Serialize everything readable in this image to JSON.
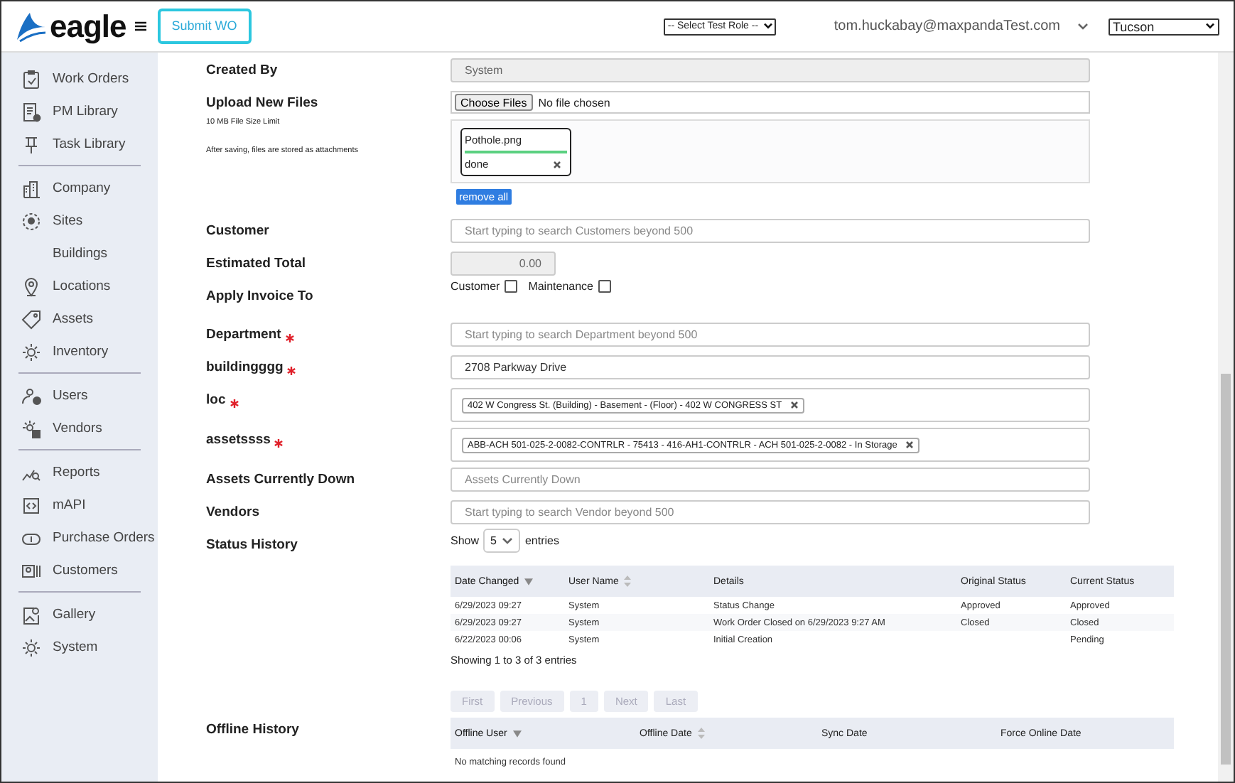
{
  "header": {
    "logo": "eagle",
    "submit_button": "Submit WO",
    "role_select": "-- Select Test Role --",
    "user": "tom.huckabay@maxpandaTest.com",
    "site_select": "Tucson"
  },
  "sidebar": {
    "groups": [
      [
        {
          "label": "Work Orders"
        },
        {
          "label": "PM Library"
        },
        {
          "label": "Task Library"
        }
      ],
      [
        {
          "label": "Company"
        },
        {
          "label": "Sites"
        },
        {
          "label": "Buildings"
        },
        {
          "label": "Locations"
        },
        {
          "label": "Assets"
        },
        {
          "label": "Inventory"
        }
      ],
      [
        {
          "label": "Users"
        },
        {
          "label": "Vendors"
        }
      ],
      [
        {
          "label": "Reports"
        },
        {
          "label": "mAPI"
        },
        {
          "label": "Purchase Orders"
        },
        {
          "label": "Customers"
        }
      ],
      [
        {
          "label": "Gallery"
        },
        {
          "label": "System"
        }
      ]
    ]
  },
  "form": {
    "fields": [
      {
        "kind": "readonly",
        "label": "Created By",
        "value": "System"
      },
      {
        "kind": "upload",
        "label": "Upload New Files",
        "notes": [
          "10 MB File Size Limit",
          "After saving, files are stored as attachments"
        ],
        "file_button": "Choose Files",
        "file_status": "No file chosen",
        "files": [
          {
            "name": "Pothole.png",
            "level": 1,
            "status": "done"
          }
        ],
        "remove_all": "remove all"
      },
      {
        "kind": "text",
        "label": "Customer",
        "placeholder": "Start typing to search Customers beyond 500"
      },
      {
        "kind": "short",
        "label": "Estimated Total",
        "value": "0.00"
      },
      {
        "kind": "checks",
        "label": "Apply Invoice To",
        "options": [
          {
            "label": "Customer",
            "checked": false
          },
          {
            "label": "Maintenance",
            "checked": false
          }
        ]
      },
      {
        "kind": "text",
        "label": "Department",
        "required": true,
        "placeholder": "Start typing to search Department beyond 500"
      },
      {
        "kind": "text",
        "label": "buildingggg",
        "required": true,
        "value": "2708 Parkway Drive"
      },
      {
        "kind": "tags",
        "label": "loc",
        "required": true,
        "tags": [
          "402 W Congress St. (Building) - Basement - (Floor) - 402 W CONGRESS ST"
        ]
      },
      {
        "kind": "tags",
        "label": "assetssss",
        "required": true,
        "tags": [
          "ABB-ACH 501-025-2-0082-CONTRLR - 75413 - 416-AH1-CONTRLR - ACH 501-025-2-0082 - In Storage"
        ]
      },
      {
        "kind": "text",
        "label": "Assets Currently Down",
        "placeholder": "Assets Currently Down"
      },
      {
        "kind": "text",
        "label": "Vendors",
        "placeholder": "Start typing to search Vendor beyond 500"
      },
      {
        "kind": "table",
        "label": "Status History",
        "length_menu": {
          "before": "Show",
          "value": "5",
          "after": "entries"
        },
        "columns": [
          {
            "label": "Date Changed",
            "sortable": true,
            "sorted": true
          },
          {
            "label": "User Name",
            "sortable": true,
            "sorted": false
          },
          {
            "label": "Details",
            "sortable": false,
            "sorted": false
          },
          {
            "label": "Original Status",
            "sortable": false,
            "sorted": false
          },
          {
            "label": "Current Status",
            "sortable": false,
            "sorted": false
          }
        ],
        "rows": [
          [
            "6/29/2023 09:27",
            "System",
            "Status Change",
            "Approved",
            "Approved"
          ],
          [
            "6/29/2023 09:27",
            "System",
            "Work Order Closed on 6/29/2023 9:27 AM",
            "Closed",
            "Closed"
          ],
          [
            "6/22/2023 00:06",
            "System",
            "Initial Creation",
            "",
            "Pending"
          ]
        ],
        "info": "Showing 1 to 3 of 3 entries",
        "pagination": [
          {
            "label": "First",
            "disabled": true
          },
          {
            "label": "Previous",
            "disabled": true
          },
          {
            "label": "1",
            "disabled": true
          },
          {
            "label": "Next",
            "disabled": true
          },
          {
            "label": "Last",
            "disabled": true
          }
        ]
      },
      {
        "kind": "table",
        "label": "Offline History",
        "columns": [
          {
            "label": "Offline User",
            "sortable": true,
            "sorted": true
          },
          {
            "label": "Offline Date",
            "sortable": true,
            "sorted": false
          },
          {
            "label": "Sync Date",
            "sortable": false,
            "sorted": false
          },
          {
            "label": "Force Online Date",
            "sortable": false,
            "sorted": false
          }
        ],
        "empty": "No matching records found"
      }
    ]
  }
}
